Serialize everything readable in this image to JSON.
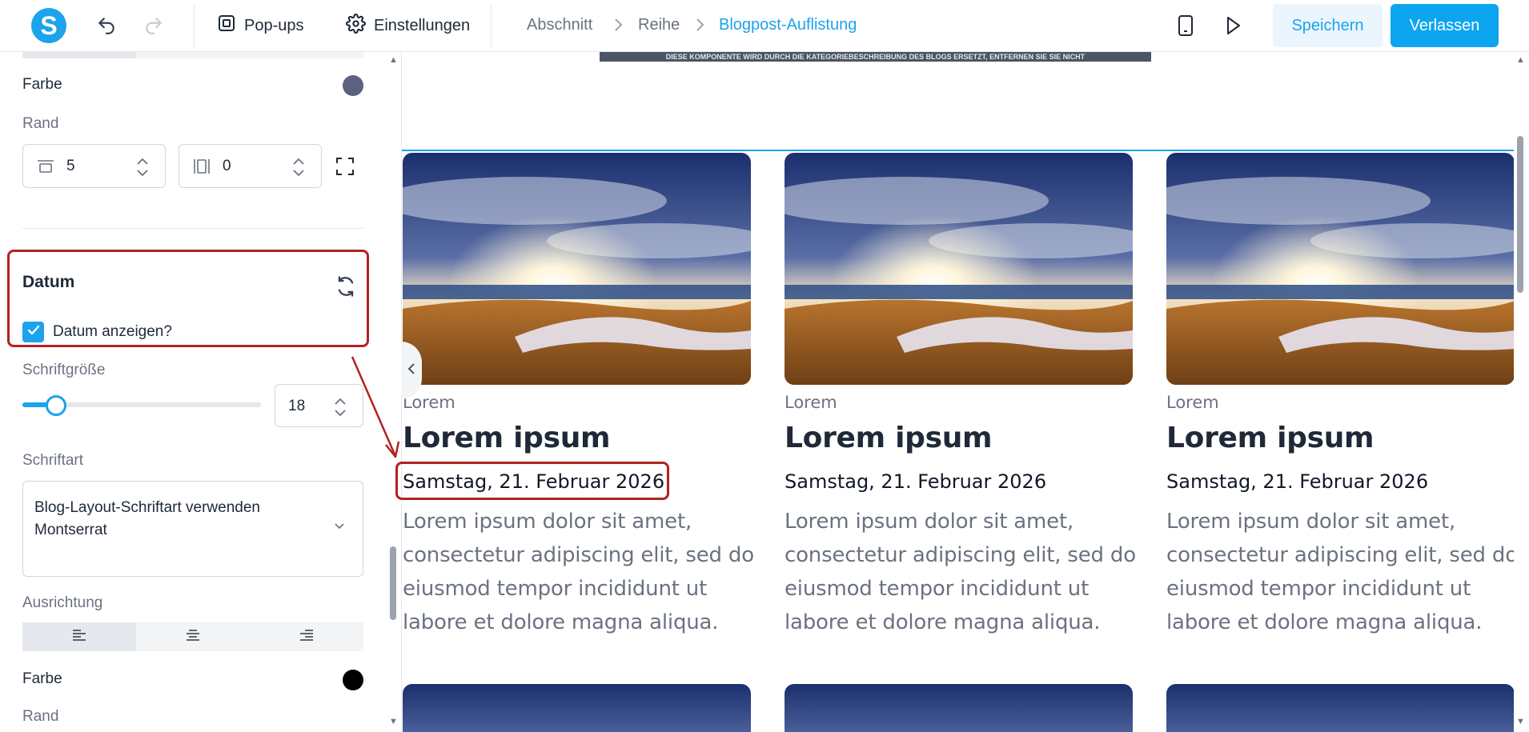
{
  "header": {
    "popups_label": "Pop-ups",
    "settings_label": "Einstellungen",
    "breadcrumbs": [
      "Abschnitt",
      "Reihe",
      "Blogpost-Auflistung"
    ],
    "save_label": "Speichern",
    "exit_label": "Verlassen"
  },
  "panel": {
    "color_label": "Farbe",
    "color_value": "#5b6181",
    "border_label": "Rand",
    "border_width": "5",
    "border_radius": "0",
    "date_section_title": "Datum",
    "show_date_label": "Datum anzeigen?",
    "show_date_checked": true,
    "font_size_label": "Schriftgröße",
    "font_size_value": "18",
    "font_size_slider_fraction": 0.12,
    "font_family_label": "Schriftart",
    "font_family_line1": "Blog-Layout-Schriftart verwenden",
    "font_family_line2": "Montserrat",
    "alignment_label": "Ausrichtung",
    "alignment_active": "left",
    "color2_label": "Farbe",
    "color2_value": "#000000",
    "border2_label": "Rand"
  },
  "canvas": {
    "notice": "DIESE KOMPONENTE WIRD DURCH DIE KATEGORIEBESCHREIBUNG DES BLOGS ERSETZT, ENTFERNEN SIE SIE NICHT",
    "posts": [
      {
        "category": "Lorem",
        "title": "Lorem ipsum",
        "date": "Samstag, 21. Februar 2026",
        "excerpt": "Lorem ipsum dolor sit amet, consectetur adipiscing elit, sed do eiusmod tempor incididunt ut labore et dolore magna aliqua."
      },
      {
        "category": "Lorem",
        "title": "Lorem ipsum",
        "date": "Samstag, 21. Februar 2026",
        "excerpt": "Lorem ipsum dolor sit amet, consectetur adipiscing elit, sed do eiusmod tempor incididunt ut labore et dolore magna aliqua."
      },
      {
        "category": "Lorem",
        "title": "Lorem ipsum",
        "date": "Samstag, 21. Februar 2026",
        "excerpt": "Lorem ipsum dolor sit amet, consectetur adipiscing elit, sed do eiusmod tempor incididunt ut labore et dolore magna aliqua."
      }
    ]
  },
  "colors": {
    "accent": "#1ca3ec",
    "annotation": "#b22222"
  }
}
